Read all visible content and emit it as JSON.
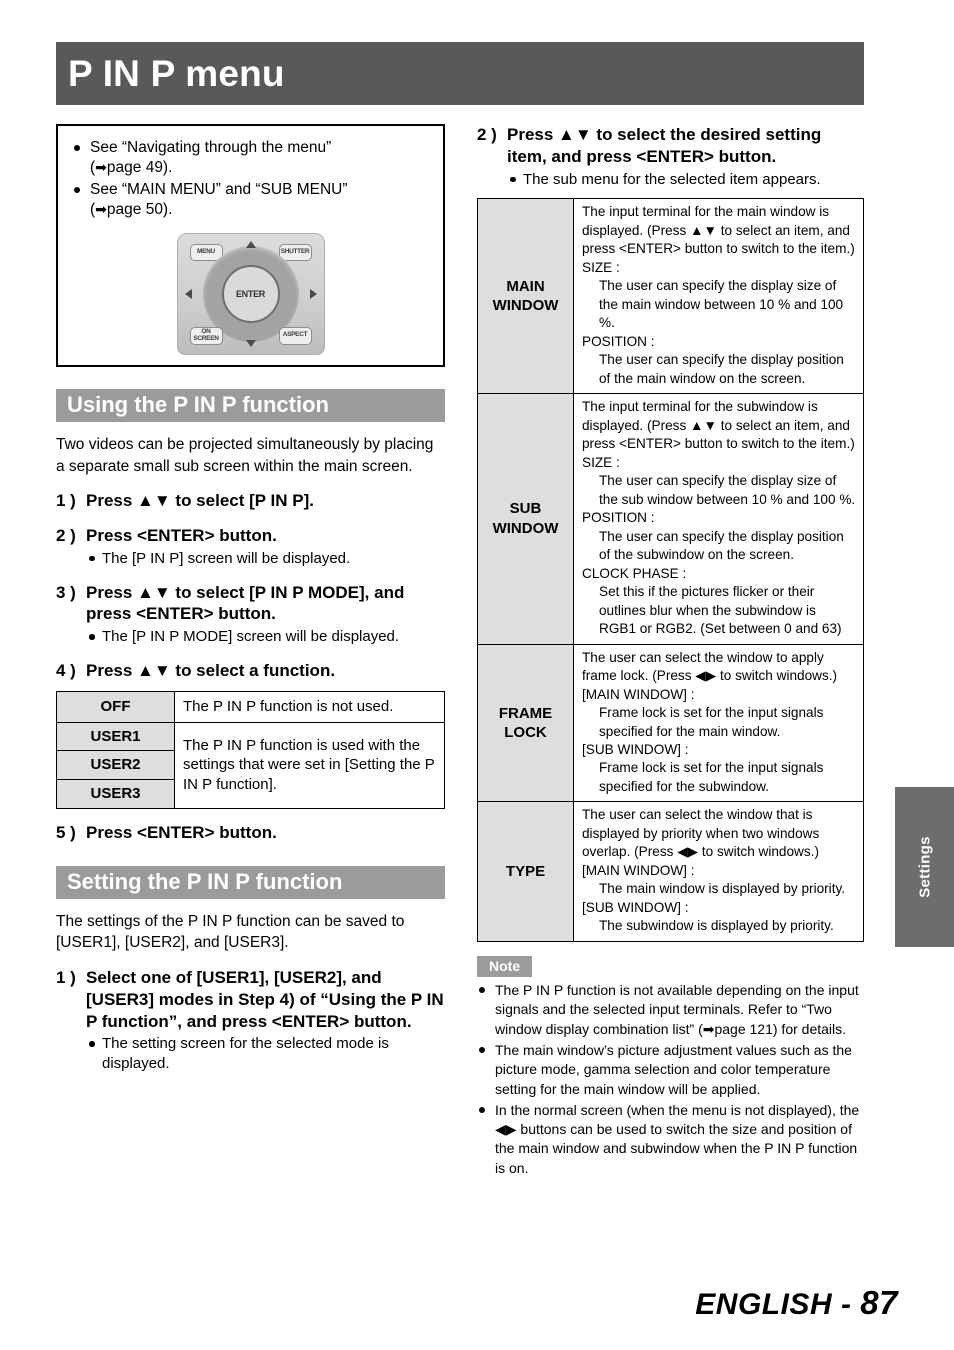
{
  "page": {
    "title": "P IN P menu",
    "side_tab_label": "Settings",
    "footer_language": "ENGLISH - ",
    "footer_page_number": "87",
    "colors": {
      "title_bar": "#595959",
      "section_bar": "#9b9b9b",
      "table_key_cell": "#dedede",
      "side_tab": "#6d6d6d",
      "note_badge": "#9b9b9b"
    }
  },
  "reference_box": {
    "items": [
      {
        "line1": "See “Navigating through the menu”",
        "line2_prefix": "(",
        "arrow": "➡",
        "line2_text": "page 49)."
      },
      {
        "line1": "See “MAIN MENU” and “SUB MENU”",
        "line2_prefix": "(",
        "arrow": "➡",
        "line2_text": "page 50)."
      }
    ],
    "remote": {
      "alt": "remote-control-diagram",
      "buttons": {
        "menu": "MENU",
        "shutter": "SHUTTER",
        "on_screen": "ON SCREEN",
        "aspect": "ASPECT",
        "enter": "ENTER"
      }
    }
  },
  "using_section": {
    "heading": "Using the P IN P function",
    "intro": "Two videos can be projected simultaneously by placing a separate small sub screen within the main screen.",
    "steps": [
      {
        "num": "1 )",
        "text": "Press ▲▼ to select [P IN P].",
        "sub": []
      },
      {
        "num": "2 )",
        "text": "Press <ENTER> button.",
        "sub": [
          "The [P IN P] screen will be displayed."
        ]
      },
      {
        "num": "3 )",
        "text": "Press ▲▼ to select [P IN P MODE], and press <ENTER> button.",
        "sub": [
          "The [P IN P MODE] screen will be displayed."
        ]
      },
      {
        "num": "4 )",
        "text": "Press ▲▼ to select a function.",
        "sub": []
      }
    ],
    "option_table": {
      "rows": [
        {
          "keys": [
            "OFF"
          ],
          "value": "The P IN P function is not used."
        },
        {
          "keys": [
            "USER1",
            "USER2",
            "USER3"
          ],
          "value": "The P IN P function is used with the settings that were set in [Setting the P IN P function]."
        }
      ]
    },
    "step5": {
      "num": "5 )",
      "text": "Press <ENTER> button."
    }
  },
  "setting_section": {
    "heading": "Setting the P IN P function",
    "intro": "The settings of the P IN P function can be saved to [USER1], [USER2], and [USER3].",
    "steps": [
      {
        "num": "1 )",
        "text": "Select one of [USER1], [USER2], and [USER3] modes in Step 4) of “Using the P IN P function”, and press <ENTER> button.",
        "sub": [
          "The setting screen for the selected mode is displayed."
        ]
      },
      {
        "num": "2 )",
        "text": "Press ▲▼ to select the desired setting item, and press <ENTER> button.",
        "sub": [
          "The sub menu for the selected item appears."
        ]
      }
    ],
    "menu_table": {
      "rows": [
        {
          "key": "MAIN WINDOW",
          "lines": [
            {
              "indent": 1,
              "text": "The input terminal for the main window is displayed. (Press ▲▼ to select an item, and press <ENTER> button to switch to the item.)"
            },
            {
              "indent": 1,
              "text": "SIZE :"
            },
            {
              "indent": 2,
              "text": "The user can specify the display size of the main window between 10 % and 100 %."
            },
            {
              "indent": 1,
              "text": "POSITION :"
            },
            {
              "indent": 2,
              "text": "The user can specify the display position of the main window on the screen."
            }
          ]
        },
        {
          "key": "SUB WINDOW",
          "lines": [
            {
              "indent": 1,
              "text": "The input terminal for the subwindow is displayed. (Press ▲▼ to select an item, and press <ENTER> button to switch to the item.)"
            },
            {
              "indent": 1,
              "text": "SIZE :"
            },
            {
              "indent": 2,
              "text": "The user can specify the display size of the sub window between 10 % and 100 %."
            },
            {
              "indent": 1,
              "text": "POSITION :"
            },
            {
              "indent": 2,
              "text": "The user can specify the display position of the subwindow on the screen."
            },
            {
              "indent": 1,
              "text": "CLOCK PHASE :"
            },
            {
              "indent": 2,
              "text": "Set this if the pictures flicker or their outlines blur when the subwindow is RGB1 or RGB2. (Set between 0 and 63)"
            }
          ]
        },
        {
          "key": "FRAME LOCK",
          "lines": [
            {
              "indent": 1,
              "text": "The user can select the window to apply frame lock. (Press ◀▶ to switch windows.)"
            },
            {
              "indent": 1,
              "text": "[MAIN WINDOW] :"
            },
            {
              "indent": 2,
              "text": "Frame lock is set for the input signals specified for the main window."
            },
            {
              "indent": 1,
              "text": "[SUB WINDOW] :"
            },
            {
              "indent": 2,
              "text": "Frame lock is set for the input signals specified for the subwindow."
            }
          ]
        },
        {
          "key": "TYPE",
          "lines": [
            {
              "indent": 1,
              "text": "The user can select the window that is displayed by priority when two windows overlap. (Press ◀▶ to switch windows.)"
            },
            {
              "indent": 1,
              "text": "[MAIN WINDOW] :"
            },
            {
              "indent": 2,
              "text": "The main window is displayed by priority."
            },
            {
              "indent": 1,
              "text": "[SUB WINDOW] :"
            },
            {
              "indent": 2,
              "text": "The subwindow is displayed by priority."
            }
          ]
        }
      ]
    }
  },
  "note": {
    "badge": "Note",
    "items": [
      "The P IN P function is not available depending on the input signals and the selected input terminals. Refer to “Two window display combination list” (➡page 121) for details.",
      "The main window’s picture adjustment values such as the picture mode, gamma selection and color temperature setting for the main window will be applied.",
      "In the normal screen (when the menu is not displayed), the ◀▶ buttons can be used to switch the size and position of the main window and subwindow when the P IN P function is on."
    ]
  }
}
